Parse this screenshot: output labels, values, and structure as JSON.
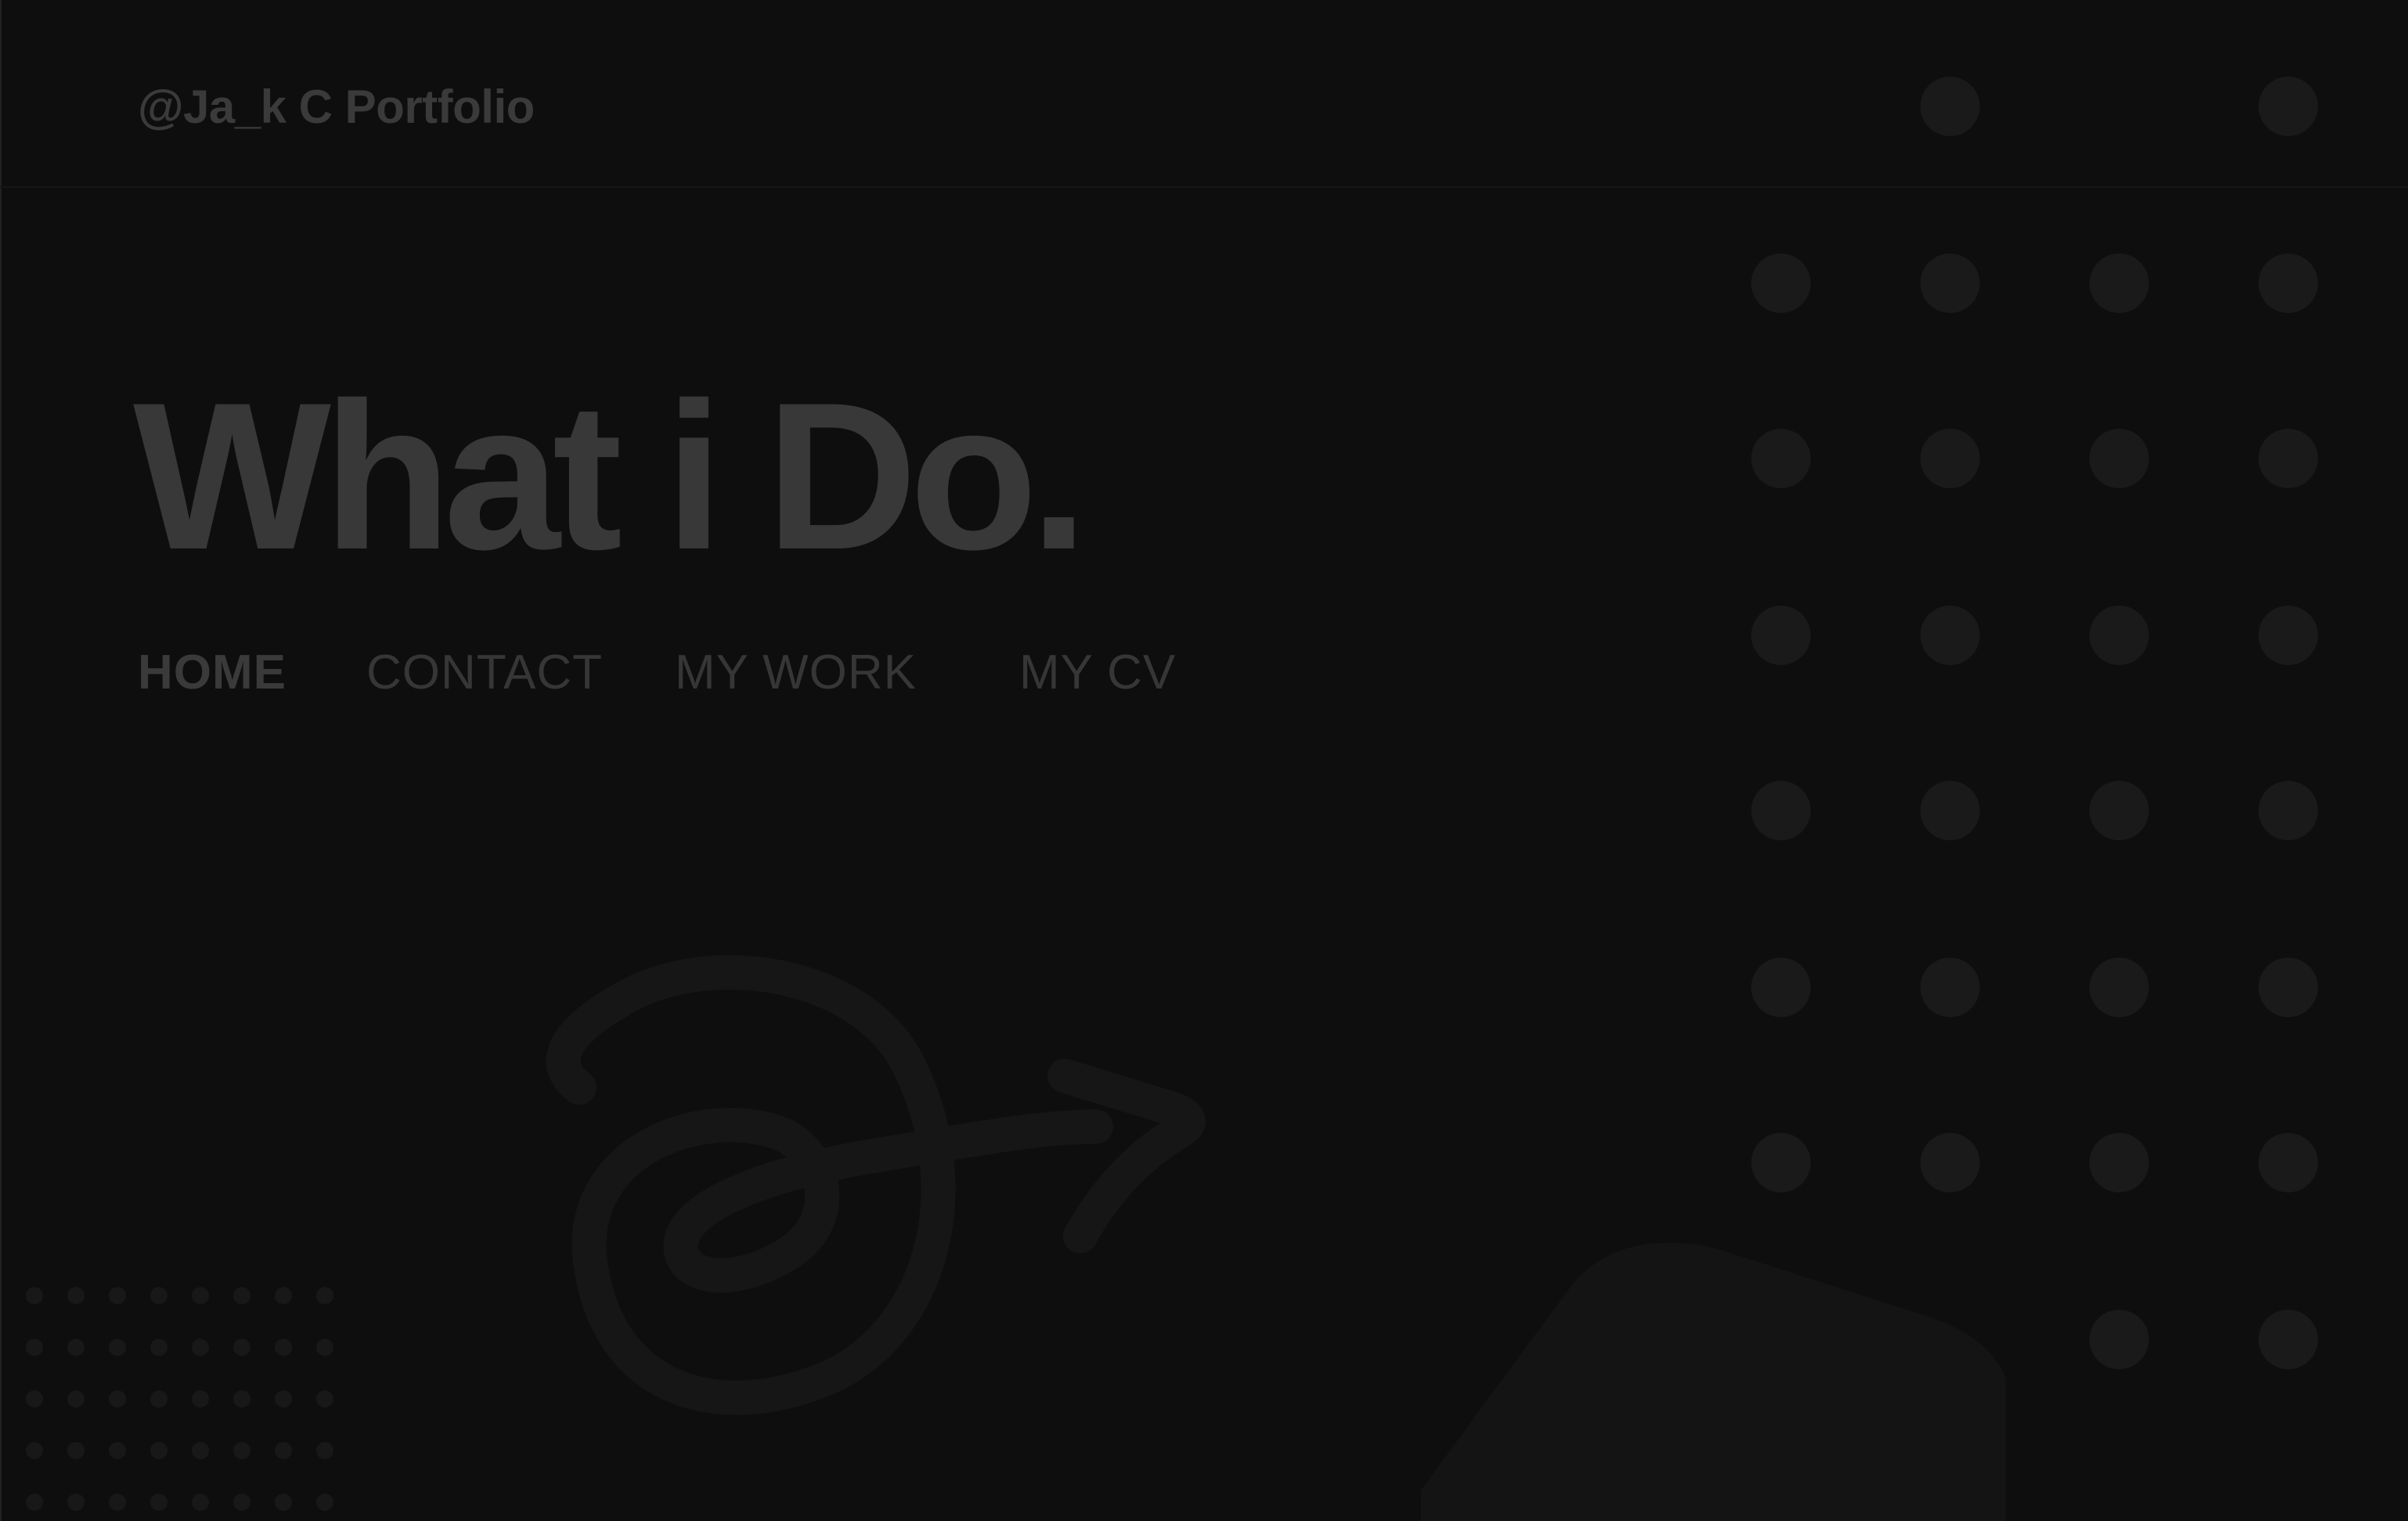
{
  "header": {
    "brand": "@Ja_k C Portfolio"
  },
  "hero": {
    "title": "What i Do."
  },
  "nav": {
    "items": [
      {
        "label": "HOME",
        "active": true
      },
      {
        "label": "CONTACT",
        "active": false
      },
      {
        "label": "MY WORK",
        "active": false
      },
      {
        "label": "MY CV",
        "active": false
      }
    ]
  },
  "colors": {
    "background": "#0e0e0e",
    "text_dim": "#383838",
    "dot": "#1b1b1b",
    "arrow": "#161616"
  },
  "decorations": {
    "dot_grid_icon": "dot-grid-icon",
    "arrow_icon": "scribble-arrow-icon",
    "shape_icon": "rounded-shape-icon"
  }
}
